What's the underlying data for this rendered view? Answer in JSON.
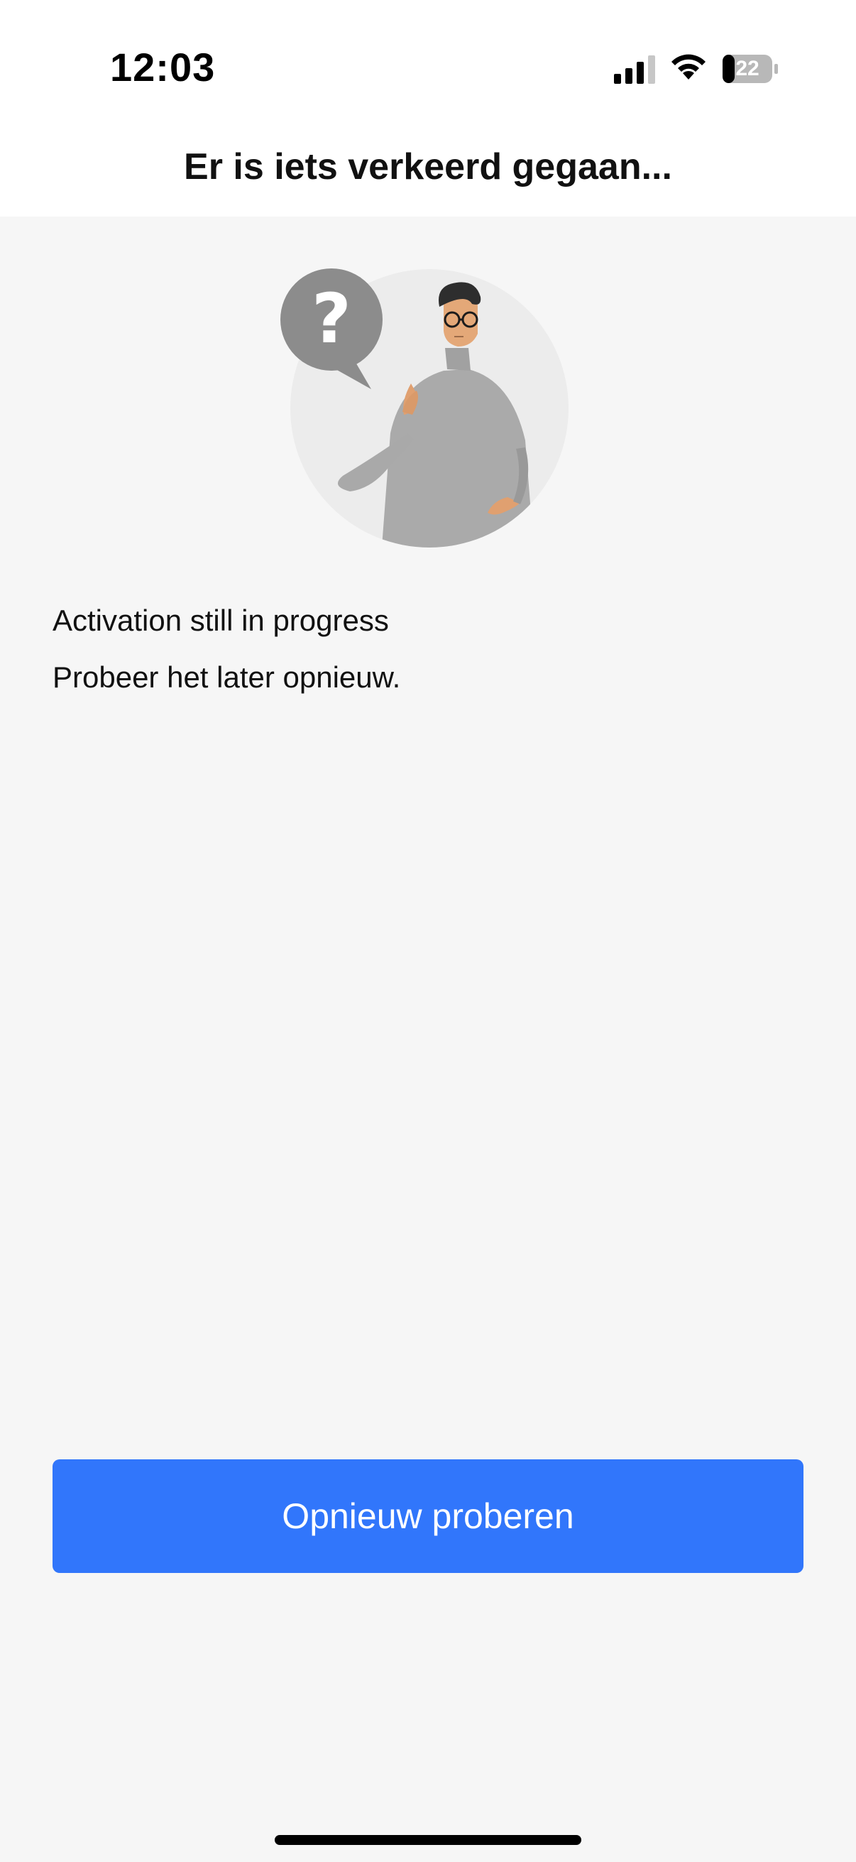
{
  "status_bar": {
    "time": "12:03",
    "battery_level": "22",
    "icons": [
      "cellular-signal-icon",
      "wifi-icon",
      "battery-icon"
    ]
  },
  "header": {
    "title": "Er is iets verkeerd gegaan..."
  },
  "illustration": {
    "icon": "confused-person-question-icon"
  },
  "message": {
    "line1": "Activation still in progress",
    "line2": "Probeer het later opnieuw."
  },
  "actions": {
    "retry_label": "Opnieuw proberen"
  },
  "colors": {
    "accent": "#3176fb",
    "background": "#f6f6f6",
    "header_background": "#ffffff"
  }
}
